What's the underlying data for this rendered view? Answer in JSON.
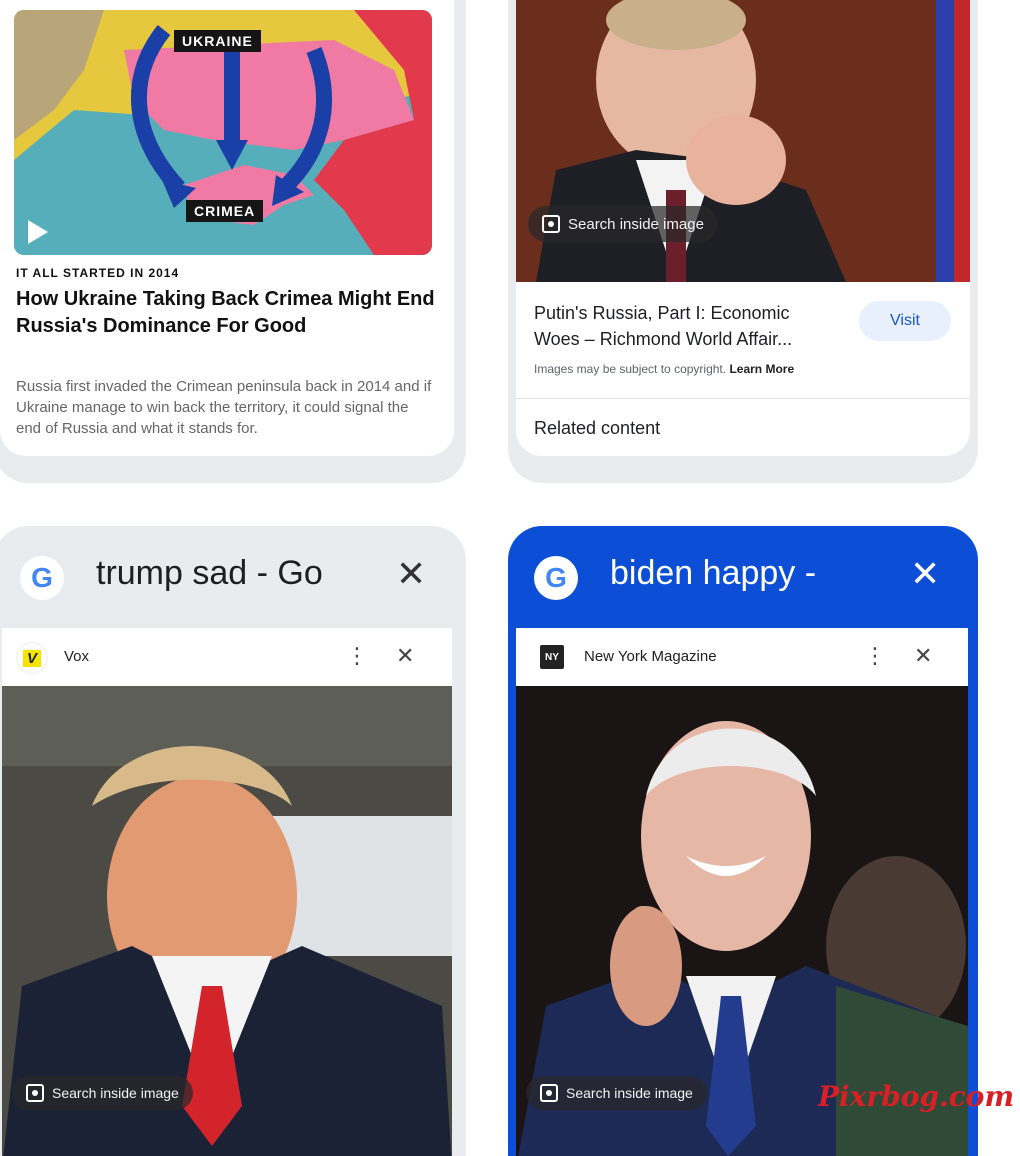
{
  "top_left_card": {
    "map_label_top": "UKRAINE",
    "map_label_bottom": "CRIMEA",
    "kicker": "IT ALL STARTED IN 2014",
    "headline": "How Ukraine Taking Back Crimea Might End Russia's Dominance For Good",
    "summary": "Russia first invaded the Crimean peninsula back in 2014 and if Ukraine manage to win back the territory, it could signal the end of Russia and what it stands for."
  },
  "top_right_card": {
    "search_inside_label": "Search inside image",
    "result_title": "Putin's Russia, Part I: Economic Woes – Richmond World Affair...",
    "visit_label": "Visit",
    "copyright_text": "Images may be subject to copyright.",
    "learn_more_label": "Learn More",
    "related_label": "Related content"
  },
  "bottom_left_tab": {
    "title": "trump sad - Go",
    "site_name": "Vox",
    "site_icon_letter": "V",
    "search_inside_label": "Search inside image"
  },
  "bottom_right_tab": {
    "title": "biden happy - ",
    "site_name": "New York Magazine",
    "site_icon_letter": "NY",
    "search_inside_label": "Search inside image",
    "active": true
  },
  "watermark": "Pixrbog.com",
  "colors": {
    "active_tab": "#0c4fd6",
    "inactive_tab": "#e9ecef",
    "visit_button_bg": "#e8f0fe",
    "watermark": "#d81f26"
  }
}
